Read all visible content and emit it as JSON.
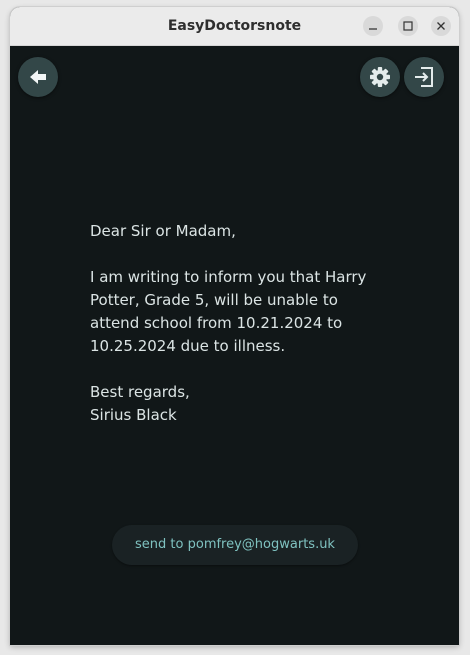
{
  "window": {
    "title": "EasyDoctorsnote"
  },
  "toolbar": {
    "back_icon": "arrow-left-icon",
    "settings_icon": "gear-icon",
    "exit_icon": "logout-icon"
  },
  "note": {
    "greeting": "Dear Sir or Madam,",
    "body": "I am writing to inform you that Harry Potter, Grade 5, will be unable to attend school from 10.21.2024 to 10.25.2024 due to illness.",
    "closing": "Best regards,",
    "signature": "Sirius Black"
  },
  "send": {
    "label": "send to pomfrey@hogwarts.uk"
  },
  "colors": {
    "background": "#111718",
    "button_bg": "#334748",
    "accent_text": "#7fc2c0"
  }
}
